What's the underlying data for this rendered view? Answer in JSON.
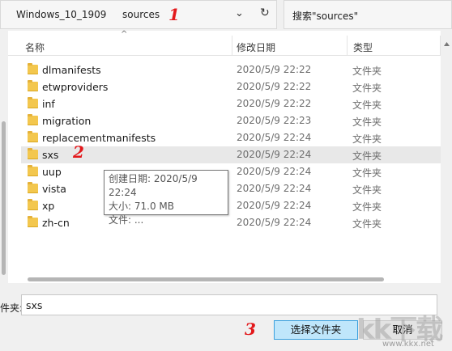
{
  "address": {
    "crumbs": [
      "Windows_10_1909",
      "sources"
    ],
    "search_placeholder": "搜索\"sources\""
  },
  "annotations": [
    "1",
    "2",
    "3"
  ],
  "columns": {
    "name": "名称",
    "date": "修改日期",
    "type": "类型"
  },
  "files": [
    {
      "name": "dlmanifests",
      "date": "2020/5/9 22:22",
      "type": "文件夹"
    },
    {
      "name": "etwproviders",
      "date": "2020/5/9 22:22",
      "type": "文件夹"
    },
    {
      "name": "inf",
      "date": "2020/5/9 22:22",
      "type": "文件夹"
    },
    {
      "name": "migration",
      "date": "2020/5/9 22:23",
      "type": "文件夹"
    },
    {
      "name": "replacementmanifests",
      "date": "2020/5/9 22:24",
      "type": "文件夹"
    },
    {
      "name": "sxs",
      "date": "2020/5/9 22:24",
      "type": "文件夹",
      "selected": true
    },
    {
      "name": "uup",
      "date": "2020/5/9 22:24",
      "type": "文件夹"
    },
    {
      "name": "vista",
      "date": "2020/5/9 22:24",
      "type": "文件夹"
    },
    {
      "name": "xp",
      "date": "2020/5/9 22:24",
      "type": "文件夹"
    },
    {
      "name": "zh-cn",
      "date": "2020/5/9 22:24",
      "type": "文件夹"
    }
  ],
  "tooltip": {
    "created": "创建日期: 2020/5/9 22:24",
    "size": "大小: 71.0 MB",
    "files": "文件: ..."
  },
  "footer": {
    "folder_label": "件夹:",
    "folder_value": "sxs",
    "select_button": "选择文件夹",
    "cancel_button": "取消"
  },
  "watermark": {
    "logo": "kk下载",
    "url": "www.kkx.net"
  }
}
